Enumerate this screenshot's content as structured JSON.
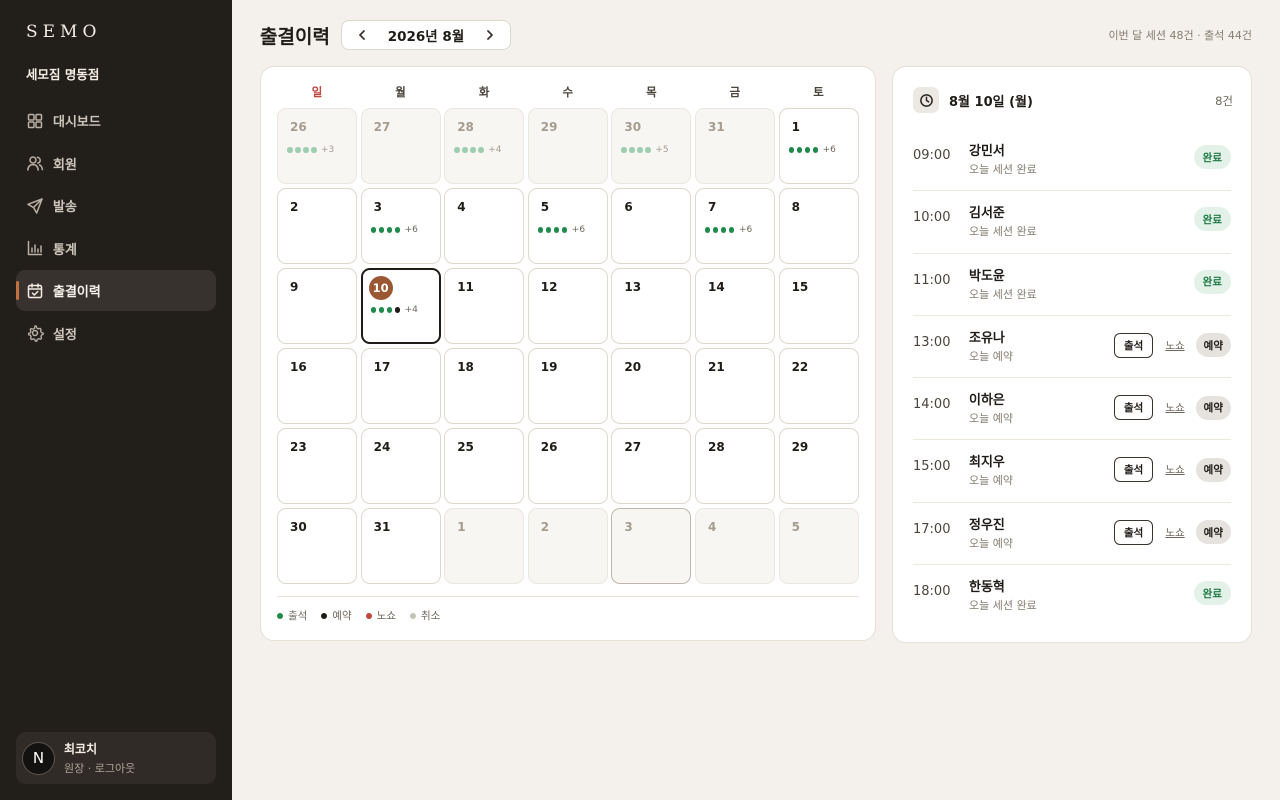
{
  "app": {
    "logo": "SEMO",
    "org": "세모짐 명동점"
  },
  "nav": [
    {
      "key": "dashboard",
      "label": "대시보드",
      "icon": "dashboard-icon",
      "active": false
    },
    {
      "key": "members",
      "label": "회원",
      "icon": "users-icon",
      "active": false
    },
    {
      "key": "send",
      "label": "발송",
      "icon": "send-icon",
      "active": false
    },
    {
      "key": "stats",
      "label": "통계",
      "icon": "chart-icon",
      "active": false
    },
    {
      "key": "attendance",
      "label": "출결이력",
      "icon": "calendar-check-icon",
      "active": true
    },
    {
      "key": "settings",
      "label": "설정",
      "icon": "gear-icon",
      "active": false
    }
  ],
  "user": {
    "avatar": "N",
    "name": "최코치",
    "sub": "원장 · 로그아웃"
  },
  "header": {
    "title": "출결이력",
    "month": "2026년 8월",
    "summary": "이번 달 세션 48건 · 출석 44건"
  },
  "colors": {
    "attend": "#1f8a4c",
    "reserved": "#1f1b17",
    "noshow": "#c0453b",
    "cancel": "#c8c2b8",
    "attend_faded": "#9fcdb1",
    "accent": "#9b5731"
  },
  "calendar": {
    "weekdays": [
      "일",
      "월",
      "화",
      "수",
      "목",
      "금",
      "토"
    ],
    "days": [
      {
        "n": "26",
        "muted": true,
        "dots": [
          "attend_faded",
          "attend_faded",
          "attend_faded",
          "attend_faded"
        ],
        "more": "+3"
      },
      {
        "n": "27",
        "muted": true
      },
      {
        "n": "28",
        "muted": true,
        "dots": [
          "attend_faded",
          "attend_faded",
          "attend_faded",
          "attend_faded"
        ],
        "more": "+4"
      },
      {
        "n": "29",
        "muted": true
      },
      {
        "n": "30",
        "muted": true,
        "dots": [
          "attend_faded",
          "attend_faded",
          "attend_faded",
          "attend_faded"
        ],
        "more": "+5"
      },
      {
        "n": "31",
        "muted": true
      },
      {
        "n": "1",
        "dots": [
          "attend",
          "attend",
          "attend",
          "attend"
        ],
        "more": "+6"
      },
      {
        "n": "2"
      },
      {
        "n": "3",
        "dots": [
          "attend",
          "attend",
          "attend",
          "attend"
        ],
        "more": "+6"
      },
      {
        "n": "4"
      },
      {
        "n": "5",
        "dots": [
          "attend",
          "attend",
          "attend",
          "attend"
        ],
        "more": "+6"
      },
      {
        "n": "6"
      },
      {
        "n": "7",
        "dots": [
          "attend",
          "attend",
          "attend",
          "attend"
        ],
        "more": "+6"
      },
      {
        "n": "8"
      },
      {
        "n": "9"
      },
      {
        "n": "10",
        "today": true,
        "dots": [
          "attend",
          "attend",
          "attend",
          "reserved"
        ],
        "more": "+4"
      },
      {
        "n": "11"
      },
      {
        "n": "12"
      },
      {
        "n": "13"
      },
      {
        "n": "14"
      },
      {
        "n": "15"
      },
      {
        "n": "16"
      },
      {
        "n": "17"
      },
      {
        "n": "18"
      },
      {
        "n": "19"
      },
      {
        "n": "20"
      },
      {
        "n": "21"
      },
      {
        "n": "22"
      },
      {
        "n": "23"
      },
      {
        "n": "24"
      },
      {
        "n": "25"
      },
      {
        "n": "26"
      },
      {
        "n": "27"
      },
      {
        "n": "28"
      },
      {
        "n": "29"
      },
      {
        "n": "30"
      },
      {
        "n": "31"
      },
      {
        "n": "1",
        "muted": true
      },
      {
        "n": "2",
        "muted": true
      },
      {
        "n": "3",
        "muted": true,
        "ring": true
      },
      {
        "n": "4",
        "muted": true
      },
      {
        "n": "5",
        "muted": true
      }
    ],
    "legend": [
      {
        "label": "출석",
        "color": "attend"
      },
      {
        "label": "예약",
        "color": "reserved"
      },
      {
        "label": "노쇼",
        "color": "noshow"
      },
      {
        "label": "취소",
        "color": "cancel"
      }
    ]
  },
  "schedule": {
    "date": "8월 10일 (월)",
    "count": "8건",
    "attend_label": "출석",
    "noshow_label": "노쇼",
    "reserved_label": "예약",
    "done_label": "완료",
    "rows": [
      {
        "time": "09:00",
        "name": "강민서",
        "sub": "오늘 세션 완료",
        "status": "done"
      },
      {
        "time": "10:00",
        "name": "김서준",
        "sub": "오늘 세션 완료",
        "status": "done"
      },
      {
        "time": "11:00",
        "name": "박도윤",
        "sub": "오늘 세션 완료",
        "status": "done"
      },
      {
        "time": "13:00",
        "name": "조유나",
        "sub": "오늘 예약",
        "status": "reserved"
      },
      {
        "time": "14:00",
        "name": "이하은",
        "sub": "오늘 예약",
        "status": "reserved"
      },
      {
        "time": "15:00",
        "name": "최지우",
        "sub": "오늘 예약",
        "status": "reserved"
      },
      {
        "time": "17:00",
        "name": "정우진",
        "sub": "오늘 예약",
        "status": "reserved"
      },
      {
        "time": "18:00",
        "name": "한동혁",
        "sub": "오늘 세션 완료",
        "status": "done"
      }
    ]
  }
}
